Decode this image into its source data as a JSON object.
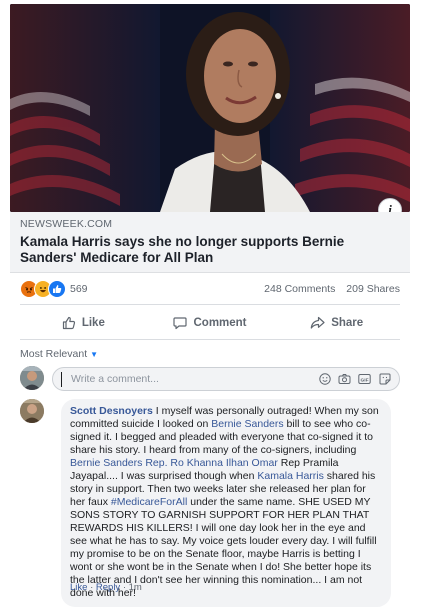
{
  "post": {
    "link": {
      "source": "NEWSWEEK.COM",
      "headline": "Kamala Harris says she no longer supports Bernie Sanders' Medicare for All Plan"
    },
    "info_button": "i",
    "reactions": {
      "icons": [
        "angry-reaction",
        "haha-reaction",
        "like-reaction"
      ],
      "count": "569"
    },
    "comments_count": "248 Comments",
    "shares_count": "209 Shares",
    "actions": {
      "like": "Like",
      "comment": "Comment",
      "share": "Share"
    }
  },
  "comments": {
    "sort_label": "Most Relevant",
    "compose_placeholder": "Write a comment...",
    "compose_icons": [
      "emoji-icon",
      "camera-icon",
      "gif-icon",
      "sticker-icon"
    ],
    "items": [
      {
        "author": "Scott Desnoyers",
        "segments": [
          {
            "text": " I myself was personally outraged! When my son committed suicide I looked on ",
            "link": false
          },
          {
            "text": "Bernie Sanders",
            "link": true
          },
          {
            "text": " bill to see who co-signed it. I begged and pleaded with everyone that co-signed it to share his story. I heard from many of the co-signers, including ",
            "link": false
          },
          {
            "text": "Bernie Sanders",
            "link": true
          },
          {
            "text": " ",
            "link": false
          },
          {
            "text": "Rep. Ro Khanna",
            "link": true
          },
          {
            "text": " ",
            "link": false
          },
          {
            "text": "Ilhan Omar",
            "link": true
          },
          {
            "text": " Rep Pramila Jayapal.... I was surprised though when ",
            "link": false
          },
          {
            "text": "Kamala Harris",
            "link": true
          },
          {
            "text": " shared his story in support. Then two weeks later she released her plan for her faux ",
            "link": false
          },
          {
            "text": "#MedicareForAll",
            "link": true
          },
          {
            "text": " under the same name. SHE USED MY SONS STORY TO GARNISH SUPPORT FOR HER PLAN THAT REWARDS HIS KILLERS! I will one day look her in the eye and see what he has to say. My voice gets louder every day. I will fulfill my promise to be on the Senate floor, maybe Harris is betting I wont or she wont be in the Senate when I do! She better hope its the latter and I don't see her winning this nomination... I am not done with her!",
            "link": false
          }
        ],
        "like_label": "Like",
        "reply_label": "Reply",
        "time": "1m"
      }
    ]
  },
  "colors": {
    "link": "#385898",
    "accent": "#1877f2",
    "muted": "#606770",
    "bubble": "#f2f3f5"
  }
}
